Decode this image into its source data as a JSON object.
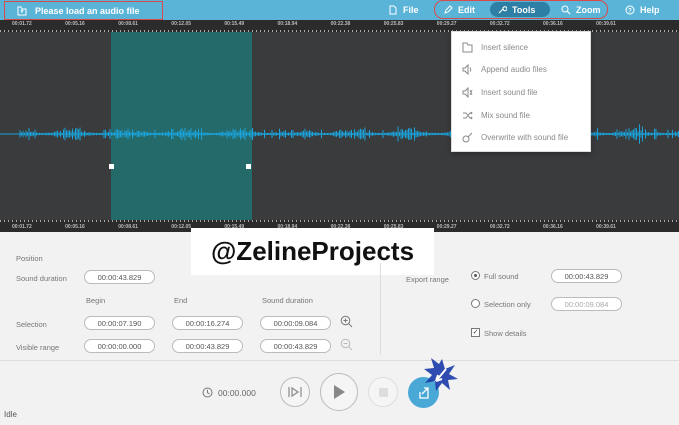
{
  "toolbar": {
    "load_label": "Please load an audio file",
    "file_label": "File",
    "edit_label": "Edit",
    "tools_label": "Tools",
    "zoom_label": "Zoom",
    "help_label": "Help"
  },
  "ruler": {
    "ticks": [
      "00:01.72",
      "00:05.16",
      "00:08.61",
      "00:12.05",
      "00:15.49",
      "00:18.94",
      "00:22.38",
      "00:25.83",
      "00:29.27",
      "00:32.72",
      "00:36.16",
      "00:39.61"
    ]
  },
  "tools_menu": {
    "items": [
      "Insert silence",
      "Append audio files",
      "Insert sound file",
      "Mix sound file",
      "Overwrite with sound file"
    ]
  },
  "watermark": "@ZelineProjects",
  "panel": {
    "position_label": "Position",
    "sound_duration_label": "Sound duration",
    "sound_duration_value": "00:00:43.829",
    "col_begin": "Begin",
    "col_end": "End",
    "col_duration": "Sound duration",
    "selection_label": "Selection",
    "selection_begin": "00:00:07.190",
    "selection_end": "00:00:16.274",
    "selection_duration": "00:00:09.084",
    "visible_label": "Visible range",
    "visible_begin": "00:00:00.000",
    "visible_end": "00:00:43.829",
    "visible_duration": "00:00:43.829",
    "export_range_label": "Export range",
    "full_sound_label": "Full sound",
    "full_sound_value": "00:00:43.829",
    "selection_only_label": "Selection only",
    "selection_only_value": "00:00:09.084",
    "show_details_label": "Show details"
  },
  "transport": {
    "time": "00:00.000"
  },
  "status": "Idle"
}
